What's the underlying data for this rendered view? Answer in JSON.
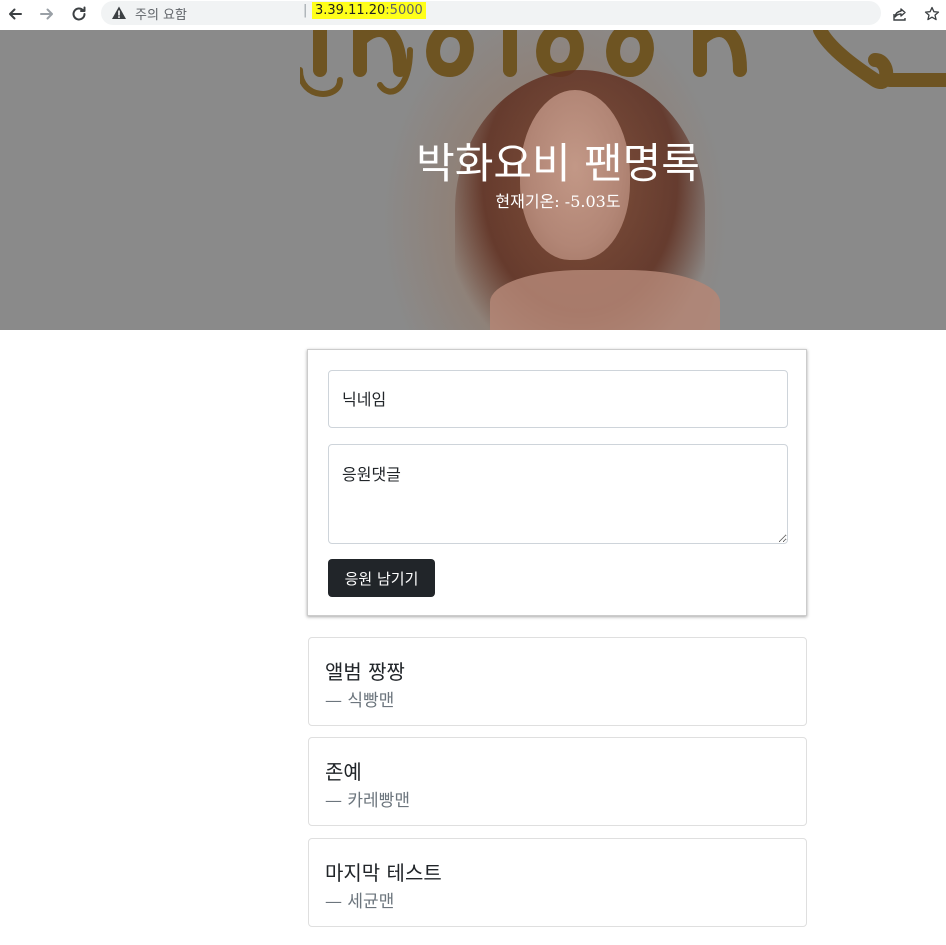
{
  "browser": {
    "warning_text": "주의 요함",
    "separator": "|",
    "url_host": "3.39.11.20",
    "url_port": ":5000",
    "back_icon": "back-arrow-icon",
    "forward_icon": "forward-arrow-icon",
    "reload_icon": "reload-icon",
    "share_icon": "share-icon",
    "bookmark_icon": "star-icon"
  },
  "hero": {
    "title": "박화요비 팬명록",
    "weather_label": "현재기온:",
    "weather_value": "-5.03도"
  },
  "form": {
    "nickname_placeholder": "닉네임",
    "comment_placeholder": "응원댓글",
    "submit_label": "응원 남기기"
  },
  "comments": [
    {
      "text": "앨범 짱짱",
      "author": "— 식빵맨"
    },
    {
      "text": "존예",
      "author": "— 카레빵맨"
    },
    {
      "text": "마지막 테스트",
      "author": "— 세균맨"
    }
  ],
  "colors": {
    "button_bg": "#212529",
    "url_highlight": "#ffff1a",
    "muted_text": "#6c757d"
  }
}
